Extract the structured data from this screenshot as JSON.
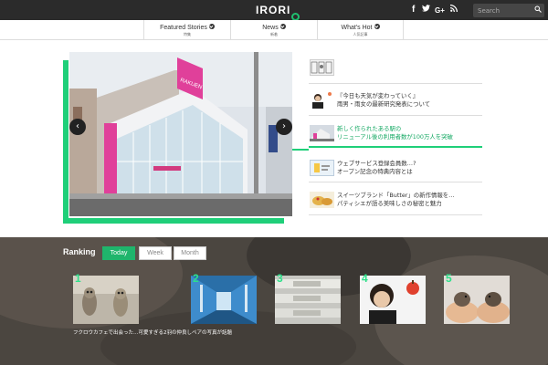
{
  "header": {
    "logo_text": "IRORI",
    "logo_last": "O",
    "social": {
      "facebook": "f",
      "twitter": "t",
      "googleplus": "G+",
      "rss": "rss"
    },
    "search_placeholder": "Search"
  },
  "nav": {
    "items": [
      {
        "label": "Featured Stories",
        "sub": "特集"
      },
      {
        "label": "News",
        "sub": "新着"
      },
      {
        "label": "What's Hot",
        "sub": "人気記事"
      }
    ]
  },
  "slider": {
    "prev": "‹",
    "next": "›",
    "sign_text": "RAKUEN"
  },
  "side_articles": [
    {
      "line1": ""
    },
    {
      "line1": "『今日も天気が変わっていく』",
      "line2": "雨男・雨女の最新研究発表について"
    },
    {
      "line1": "新しく作られたある駅の",
      "line2": "リニューアル後の利用者数が100万人を突破"
    },
    {
      "line1": "ウェブサービス登録会員数…?",
      "line2": "オープン記念の特典内容とは"
    },
    {
      "line1": "スイーツブランド「Butter」の新作情報を…",
      "line2": "パティシエが語る美味しさの秘密と魅力"
    }
  ],
  "ranking": {
    "title": "Ranking",
    "tabs": [
      "Today",
      "Week",
      "Month"
    ],
    "items": [
      {
        "num": "1"
      },
      {
        "num": "2"
      },
      {
        "num": "3"
      },
      {
        "num": "4"
      },
      {
        "num": "5"
      }
    ],
    "caption": "フクロウカフェで出会った…可愛すぎる2羽の仲良しペアの写真が話題"
  },
  "colors": {
    "accent": "#1fcf79",
    "topbar": "#2b2b2b"
  },
  "icons": [
    "search-icon",
    "facebook-icon",
    "twitter-icon",
    "google-plus-icon",
    "rss-icon",
    "chevron-down-icon",
    "arrow-left-icon",
    "arrow-right-icon"
  ]
}
